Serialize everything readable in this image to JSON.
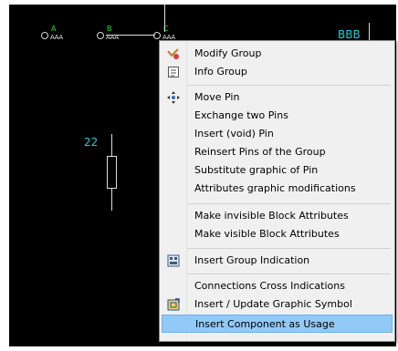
{
  "canvas": {
    "pins": [
      {
        "letter": "A",
        "name": "AAA"
      },
      {
        "letter": "B",
        "name": "AAA"
      },
      {
        "letter": "C",
        "name": "AAA"
      }
    ],
    "label_bbb": "BBB",
    "label_22": "22"
  },
  "menu": {
    "items": [
      {
        "label": "Modify Group",
        "icon": "modify-group-icon"
      },
      {
        "label": "Info Group",
        "icon": "info-group-icon"
      },
      {
        "label": "Move Pin",
        "icon": "move-pin-icon"
      },
      {
        "label": "Exchange two Pins"
      },
      {
        "label": "Insert (void) Pin"
      },
      {
        "label": "Reinsert Pins of the Group"
      },
      {
        "label": "Substitute graphic of Pin"
      },
      {
        "label": "Attributes graphic modifications"
      },
      {
        "label": "Make invisible Block Attributes"
      },
      {
        "label": "Make visible Block Attributes"
      },
      {
        "label": "Insert Group Indication",
        "icon": "group-indication-icon"
      },
      {
        "label": "Connections Cross Indications"
      },
      {
        "label": "Insert / Update Graphic Symbol",
        "icon": "graphic-symbol-icon"
      },
      {
        "label": "Insert Component as Usage",
        "highlighted": true
      }
    ]
  },
  "colors": {
    "canvas_bg": "#000000",
    "pin_letter": "#19e619",
    "text_cyan": "#1ad0e0",
    "menu_bg": "#f0f0f0",
    "highlight": "#91c9f7"
  }
}
